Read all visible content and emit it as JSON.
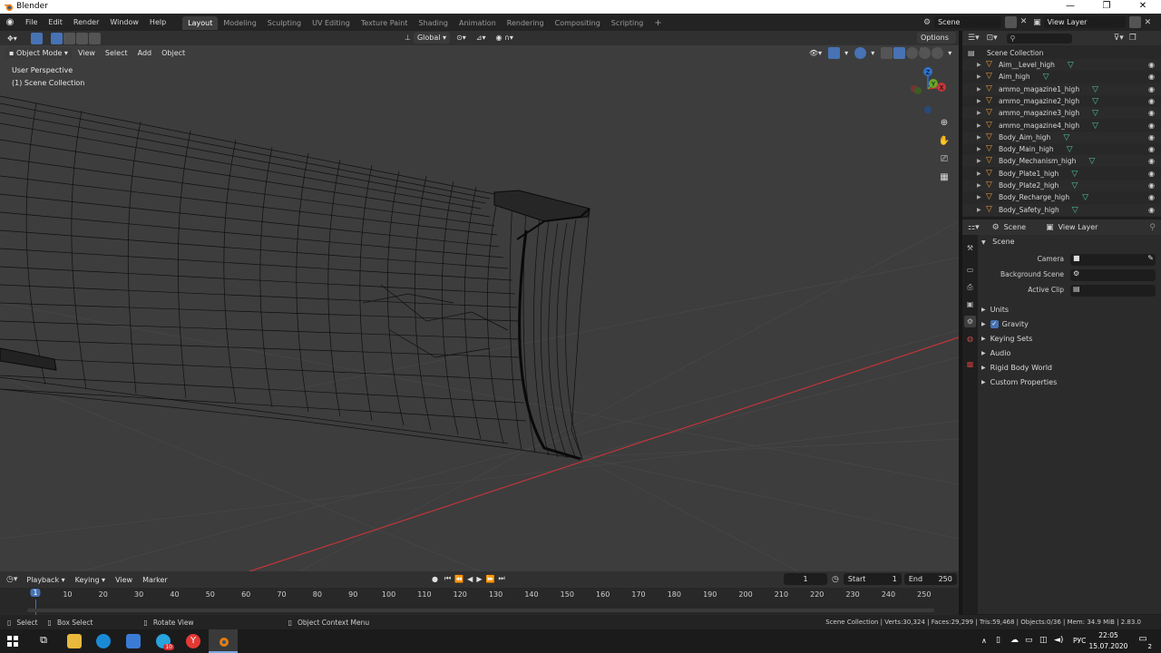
{
  "window": {
    "title": "Blender",
    "minimize": "—",
    "maximize": "❐",
    "close": "✕"
  },
  "topbar": {
    "menus": [
      "File",
      "Edit",
      "Render",
      "Window",
      "Help"
    ],
    "workspaces": [
      "Layout",
      "Modeling",
      "Sculpting",
      "UV Editing",
      "Texture Paint",
      "Shading",
      "Animation",
      "Rendering",
      "Compositing",
      "Scripting"
    ],
    "active_workspace": "Layout",
    "add_workspace": "+",
    "scene_name": "Scene",
    "view_layer": "View Layer"
  },
  "viewport": {
    "transform_orientation": "Global",
    "options_label": "Options",
    "mode": "Object Mode",
    "menus": [
      "View",
      "Select",
      "Add",
      "Object"
    ],
    "perspective_label": "User Perspective",
    "collection_label": "(1) Scene Collection",
    "gizmo": {
      "x": "X",
      "y": "Y",
      "z": "Z"
    },
    "colors": {
      "background": "#3d3d3d",
      "x_axis": "#c2353a",
      "wire": "#0a0a0a"
    }
  },
  "outliner": {
    "search_placeholder": "",
    "root": "Scene Collection",
    "items": [
      "Aim__Level_high",
      "Aim_high",
      "ammo_magazine1_high",
      "ammo_magazine2_high",
      "ammo_magazine3_high",
      "ammo_magazine4_high",
      "Body_Aim_high",
      "Body_Main_high",
      "Body_Mechanism_high",
      "Body_Plate1_high",
      "Body_Plate2_high",
      "Body_Recharge_high",
      "Body_Safety_high"
    ]
  },
  "properties": {
    "breadcrumb_scene": "Scene",
    "breadcrumb_view_layer": "View Layer",
    "panel_title": "Scene",
    "fields": [
      {
        "label": "Camera",
        "value": ""
      },
      {
        "label": "Background Scene",
        "value": ""
      },
      {
        "label": "Active Clip",
        "value": ""
      }
    ],
    "subpanels": [
      "Units",
      "Gravity",
      "Keying Sets",
      "Audio",
      "Rigid Body World",
      "Custom Properties"
    ],
    "gravity_checked": true
  },
  "timeline": {
    "menus": [
      "Playback",
      "Keying",
      "View",
      "Marker"
    ],
    "current_frame": "1",
    "start_label": "Start",
    "start_value": "1",
    "end_label": "End",
    "end_value": "250",
    "ruler": [
      "1",
      "10",
      "20",
      "30",
      "40",
      "50",
      "60",
      "70",
      "80",
      "90",
      "100",
      "110",
      "120",
      "130",
      "140",
      "150",
      "160",
      "170",
      "180",
      "190",
      "200",
      "210",
      "220",
      "230",
      "240",
      "250"
    ]
  },
  "statusbar": {
    "select": "Select",
    "box_select": "Box Select",
    "rotate_view": "Rotate View",
    "context_menu": "Object Context Menu",
    "stats": "Scene Collection | Verts:30,324 | Faces:29,299 | Tris:59,468 | Objects:0/36 | Mem: 34.9 MiB | 2.83.0"
  },
  "taskbar": {
    "lang": "РУС",
    "time": "22:05",
    "date": "15.07.2020",
    "notification_count": "2",
    "badge": "10"
  }
}
